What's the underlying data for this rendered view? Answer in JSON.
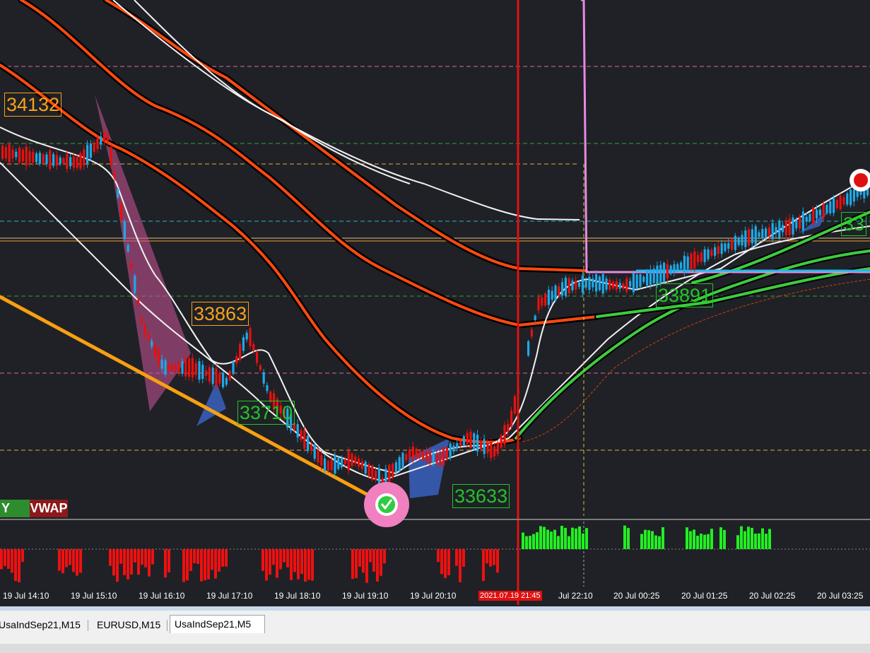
{
  "window": {
    "symbol": "UsaIndSep21",
    "timeframe": "M5"
  },
  "price_labels": [
    {
      "text": "34132",
      "color": "orange"
    },
    {
      "text": "33863",
      "color": "orange"
    },
    {
      "text": "33710",
      "color": "green"
    },
    {
      "text": "33633",
      "color": "green"
    },
    {
      "text": "33891",
      "color": "green"
    },
    {
      "text": "33",
      "color": "green"
    }
  ],
  "indicator_buttons": {
    "left": "Y",
    "vwap": "VWAP"
  },
  "time_axis": {
    "labels": [
      "19 Jul 14:10",
      "19 Jul 15:10",
      "19 Jul 16:10",
      "19 Jul 17:10",
      "19 Jul 18:10",
      "19 Jul 19:10",
      "19 Jul 20:10",
      "Jul 22:10",
      "20 Jul 00:25",
      "20 Jul 01:25",
      "20 Jul 02:25",
      "20 Jul 03:25"
    ],
    "cursor_time": "2021.07.19 21:45"
  },
  "tabs": [
    {
      "label": "UsaIndSep21,M15",
      "active": false
    },
    {
      "label": "EURUSD,M15",
      "active": false
    },
    {
      "label": "UsaIndSep21,M5",
      "active": true
    }
  ],
  "colors": {
    "background": "#1f2126",
    "bull_candle": "#1fa8e8",
    "bear_candle": "#e81010",
    "ma_orange": "#ff4a10",
    "ma_green": "#3ecb3e",
    "trend_orange": "#f8a010",
    "vertical_cursor": "#e01010",
    "vwap_violet": "#e88ae0",
    "hist_positive": "#22ee22",
    "hist_negative": "#ee1111"
  },
  "signals": [
    {
      "name": "buy-signal",
      "icon": "check-circle-icon",
      "color": "#2ecc40"
    },
    {
      "name": "sell-signal",
      "icon": "target-circle-icon",
      "color": "#e01010"
    }
  ]
}
